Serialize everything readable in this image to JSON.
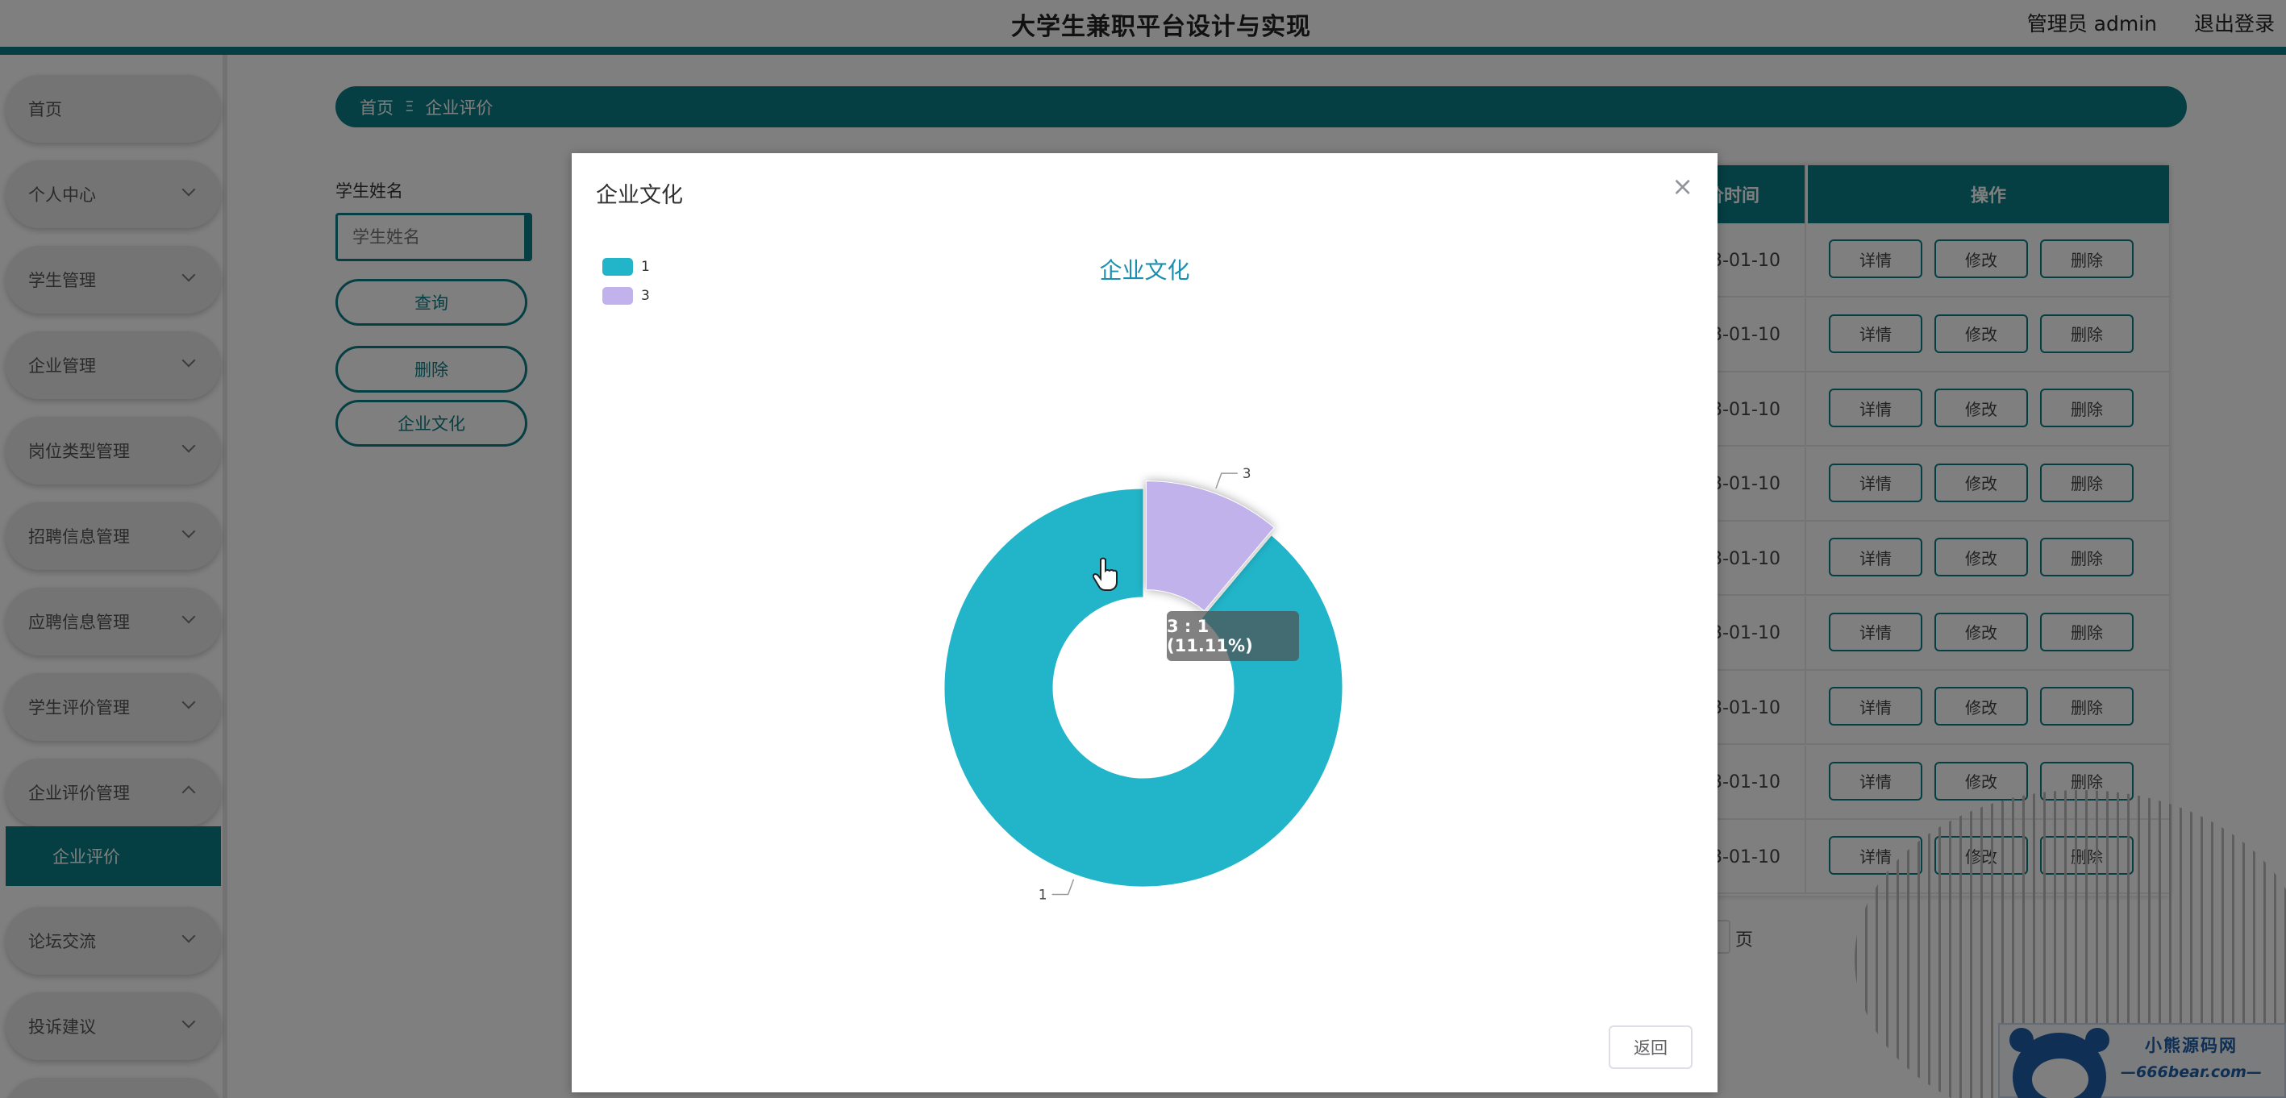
{
  "header": {
    "site_title": "大学生兼职平台设计与实现",
    "admin_label": "管理员 admin",
    "logout": "退出登录"
  },
  "sidebar": {
    "items": [
      {
        "label": "首页",
        "has_arrow": false
      },
      {
        "label": "个人中心",
        "has_arrow": true
      },
      {
        "label": "学生管理",
        "has_arrow": true
      },
      {
        "label": "企业管理",
        "has_arrow": true
      },
      {
        "label": "岗位类型管理",
        "has_arrow": true
      },
      {
        "label": "招聘信息管理",
        "has_arrow": true
      },
      {
        "label": "应聘信息管理",
        "has_arrow": true
      },
      {
        "label": "学生评价管理",
        "has_arrow": true
      },
      {
        "label": "企业评价管理",
        "has_arrow": true,
        "expanded": true
      },
      {
        "label": "论坛交流",
        "has_arrow": true
      },
      {
        "label": "投诉建议",
        "has_arrow": true
      }
    ],
    "active_sub": "企业评价"
  },
  "breadcrumb": {
    "home": "首页",
    "separator": "Ξ",
    "current": "企业评价"
  },
  "search": {
    "label": "学生姓名",
    "placeholder": "学生姓名",
    "query_button": "查询",
    "delete_button": "删除",
    "culture_button": "企业文化"
  },
  "table": {
    "time_header_visible": "价时间",
    "op_header": "操作",
    "dates_visible": [
      "3-01-10",
      "3-01-10",
      "3-01-10",
      "3-01-10",
      "3-01-10",
      "3-01-10",
      "3-01-10",
      "3-01-10",
      "3-01-10"
    ],
    "actions": {
      "detail": "详情",
      "edit": "修改",
      "delete": "删除"
    },
    "pager_unit": "页"
  },
  "watermark": {
    "line1": "小熊源码网",
    "line2": "—666bear.com—"
  },
  "modal": {
    "title": "企业文化",
    "close_icon": "×",
    "back_button": "返回"
  },
  "chart_data": {
    "type": "pie",
    "variant": "donut",
    "title": "企业文化",
    "legend_position": "top-left",
    "series": [
      {
        "name": "1",
        "value": 8,
        "color": "#22b5c9"
      },
      {
        "name": "3",
        "value": 1,
        "color": "#c2b2ec"
      }
    ],
    "slice_labels": [
      "1",
      "3"
    ],
    "tooltip": "3 : 1 (11.11%)",
    "highlighted": "3"
  },
  "colors": {
    "accent": "#0b7f86",
    "chart_title": "#1a8fb0"
  }
}
